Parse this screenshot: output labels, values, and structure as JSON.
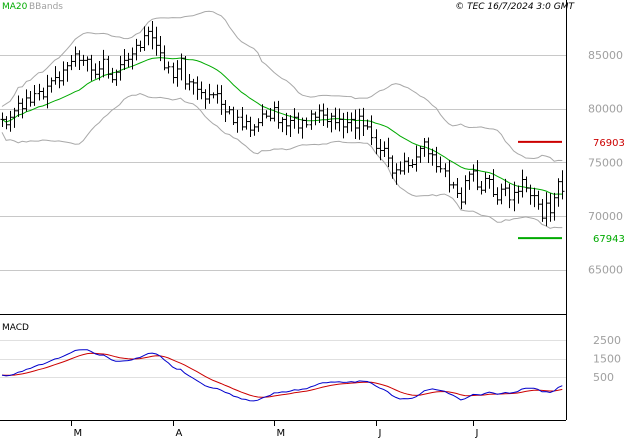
{
  "chart_data": [
    {
      "type": "ohlc",
      "legend": [
        {
          "label": "MA20",
          "color": "#00aa00"
        },
        {
          "label": "BBands",
          "color": "#a0a0a0"
        }
      ],
      "copyright": "© TEC 16/7/2024 3:0 GMT",
      "ylim": [
        60000,
        90000
      ],
      "y_ticks": [
        {
          "value": 65000,
          "label": "65000"
        },
        {
          "value": 70000,
          "label": "70000"
        },
        {
          "value": 75000,
          "label": "75000"
        },
        {
          "value": 80000,
          "label": "80000"
        },
        {
          "value": 85000,
          "label": "85000"
        }
      ],
      "grid": true,
      "levels": [
        {
          "value": 76903,
          "label": "76903",
          "color": "#cc0000"
        },
        {
          "value": 67943,
          "label": "67943",
          "color": "#00aa00"
        }
      ],
      "months": [
        "M",
        "A",
        "M",
        "J",
        "J"
      ],
      "month_index": [
        17,
        42,
        67,
        92,
        116
      ],
      "n_bars": 126,
      "closes": [
        79000,
        78500,
        79200,
        79800,
        80500,
        80000,
        81000,
        80600,
        81400,
        81600,
        81100,
        82100,
        82600,
        82900,
        82600,
        83600,
        84000,
        84400,
        85100,
        84500,
        84500,
        84600,
        83600,
        83200,
        83700,
        84600,
        83200,
        82700,
        83400,
        84100,
        84500,
        84600,
        85100,
        85900,
        85700,
        86800,
        87200,
        86600,
        85900,
        85200,
        83800,
        83900,
        82900,
        83700,
        84700,
        82300,
        82500,
        82400,
        81800,
        81500,
        80900,
        81300,
        81300,
        81400,
        80400,
        79700,
        79900,
        78700,
        79200,
        78300,
        78800,
        78000,
        78300,
        78700,
        79500,
        79300,
        79100,
        80100,
        78700,
        79000,
        78400,
        78900,
        79200,
        78200,
        78900,
        78500,
        79500,
        79200,
        79800,
        79400,
        78800,
        79300,
        78700,
        79000,
        78300,
        78700,
        79000,
        78200,
        79300,
        78400,
        78300,
        77300,
        76300,
        76100,
        76300,
        75400,
        74000,
        74300,
        74200,
        75100,
        74700,
        74800,
        75500,
        76300,
        76900,
        75800,
        75700,
        74600,
        74400,
        74200,
        72900,
        72900,
        72100,
        71300,
        73300,
        73900,
        74200,
        72700,
        72400,
        73500,
        73400,
        72000,
        71500,
        72500,
        72600,
        71500,
        72200,
        72300,
        73400,
        72600,
        71900,
        71900,
        71100,
        69800,
        71200,
        70300,
        71700,
        73200,
        72300
      ]
    },
    {
      "type": "line",
      "title": "MACD",
      "y_ticks": [
        {
          "value": 2500,
          "label": "2500"
        },
        {
          "value": 1500,
          "label": "1500"
        },
        {
          "value": 500,
          "label": "500"
        }
      ],
      "series": [
        {
          "color": "#0000cc"
        },
        {
          "color": "#cc0000"
        }
      ]
    }
  ]
}
